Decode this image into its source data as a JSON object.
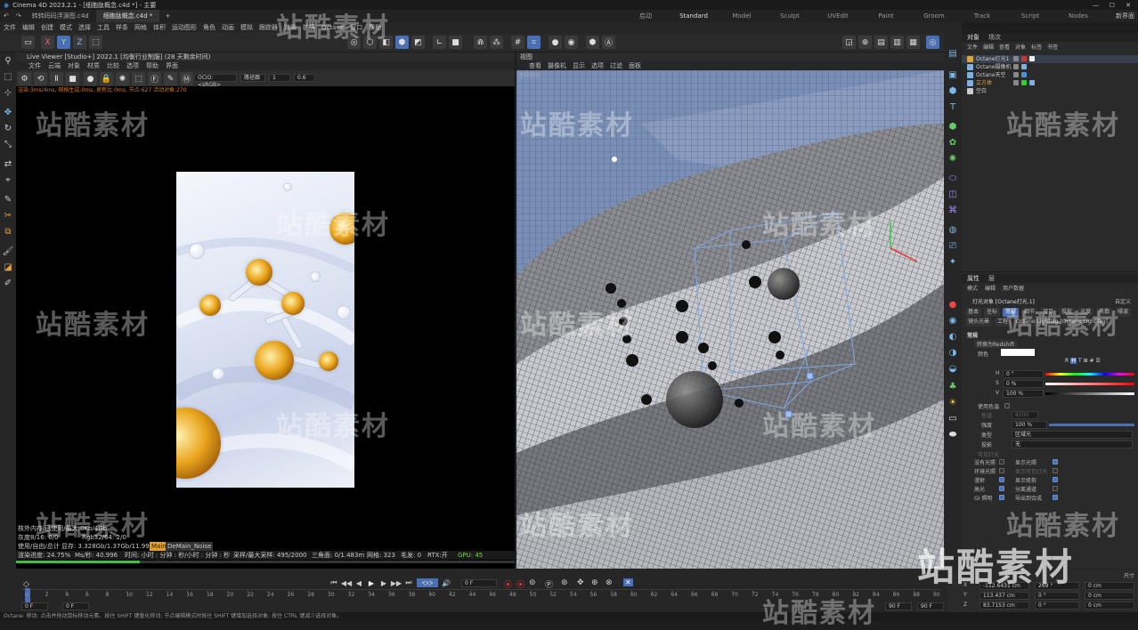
{
  "window": {
    "title": "Cinema 4D 2023.2.1 - [细胞肽概念.c4d *] - 主要"
  },
  "tabs": [
    {
      "label": "转转码码浮源图.c4d"
    },
    {
      "label": "细胞肽概念.c4d *"
    }
  ],
  "layouts": [
    "启动",
    "Standard",
    "Model",
    "Sculpt",
    "UVEdit",
    "Paint",
    "Groom",
    "Track",
    "Script",
    "Nodes"
  ],
  "layout_extra": "新界面",
  "menu": [
    "文件",
    "编辑",
    "创建",
    "模式",
    "选择",
    "工具",
    "样条",
    "网格",
    "体积",
    "运动图形",
    "角色",
    "动画",
    "模拟",
    "跟踪器",
    "渲染",
    "扩展",
    "Octane",
    "窗口",
    "帮助"
  ],
  "live_viewer": {
    "title": "Live Viewer [Studio+] 2022.1 [均衡行业制服] (28 天剩余时间)",
    "menu": [
      "文件",
      "云端",
      "对象",
      "材质",
      "比较",
      "选项",
      "帮助",
      "界面"
    ],
    "color_mode": "OCIO:<sRGB>",
    "preset": "路径跟",
    "value1": "1",
    "value2": "0.6",
    "status": "渲染:3ms/4ms, 网格生成:0ms, 更新比:0ms, 节点:627 活动对象:270",
    "stats": {
      "mem": "核外内存 已使用/最大:0Kb/4Gb",
      "gray": "灰度8/16: 0/0",
      "rgb": "Rgb32/64: 2/0",
      "vram_label": "使用/自由/总计 显存: 3.328Gb/1.37Gb/11.99",
      "pass_main": "Main",
      "pass_noise": "DeMain_Noise",
      "progress_label": "渲染进度: 24.75%",
      "ms": "Ms/秒: 40.996",
      "time": "时间: 小时 : 分钟 : 秒/小时 : 分钟 : 秒",
      "samples": "采样/最大采样: 495/2000",
      "tris": "三角面: 0/1.483m",
      "mesh": "网格: 323",
      "hair": "毛发: 0",
      "rtx": "RTX:开",
      "gpu": "GPU: 45",
      "progress": 0.2475
    }
  },
  "viewport": {
    "title": "视图",
    "menu": [
      "查看",
      "摄像机",
      "显示",
      "选项",
      "过滤",
      "面板"
    ],
    "tag": "透视视图"
  },
  "object_manager": {
    "tabs": [
      "对象",
      "场次"
    ],
    "menu": [
      "文件",
      "编辑",
      "查看",
      "对象",
      "标签",
      "书签"
    ],
    "objects": [
      {
        "name": "Octane灯光1",
        "color": "#d9a640"
      },
      {
        "name": "Octane摄像机",
        "color": "#7fb0e0"
      },
      {
        "name": "Octane天空",
        "color": "#7fb0e0"
      },
      {
        "name": "立方体",
        "color": "#7fb0e0"
      },
      {
        "name": "空白",
        "color": "#cccccc"
      }
    ]
  },
  "attributes": {
    "tabs": [
      "属性",
      "层"
    ],
    "menu": [
      "模式",
      "编辑",
      "用户数据"
    ],
    "object_title": "灯光对象 [Octane灯光.1]",
    "custom": "自定义",
    "subtabs1": [
      "基本",
      "坐标",
      "常规",
      "细节",
      "可见",
      "投影",
      "光度",
      "焦散",
      "噪波"
    ],
    "subtabs2": [
      "镜头光晕",
      "工程",
      "Octane Lightlag [Octane LightTag]"
    ],
    "section": "常规",
    "convert": "转换为Redshift",
    "color_label": "颜色",
    "h_label": "H",
    "h_value": "0 °",
    "s_label": "S",
    "s_value": "0 %",
    "v_label": "V",
    "v_value": "100 %",
    "use_temp": "使用色温",
    "temp_label": "色温",
    "temp_value": "6500",
    "intensity_label": "强度",
    "intensity_value": "100 %",
    "type_label": "类型",
    "type_value": "区域光",
    "shadow_label": "投影",
    "shadow_value": "无",
    "visible_light": "可见灯光",
    "opts_left": [
      "没有光照",
      "环境光照",
      "漫射",
      "高光",
      "GI 照明"
    ],
    "opts_right": [
      "显示光照",
      "显示可见灯光",
      "显示修剪",
      "分离通道",
      "导出到合成"
    ]
  },
  "timeline": {
    "current_frame": "0 F",
    "start": "0 F",
    "start2": "0 F",
    "end": "90 F",
    "end2": "90 F",
    "ticks": [
      "0",
      "2",
      "4",
      "6",
      "8",
      "10",
      "12",
      "14",
      "16",
      "18",
      "20",
      "22",
      "24",
      "26",
      "28",
      "30",
      "32",
      "34",
      "36",
      "38",
      "40",
      "42",
      "44",
      "46",
      "48",
      "50",
      "52",
      "54",
      "56",
      "58",
      "60",
      "62",
      "64",
      "66",
      "68",
      "70",
      "72",
      "74",
      "76",
      "78",
      "80",
      "82",
      "84",
      "86",
      "88",
      "90"
    ],
    "coords": [
      {
        "axis": "X",
        "pos": "-112.6431 cm",
        "rot": "269 °",
        "size": "0 cm"
      },
      {
        "axis": "Y",
        "pos": "113.437 cm",
        "rot": "0 °",
        "size": "0 cm"
      },
      {
        "axis": "Z",
        "pos": "83.7153 cm",
        "rot": "0 °",
        "size": "0 cm"
      }
    ],
    "coord_mode": "尺寸"
  },
  "status": "Octane:    移动: 点击并拖动鼠标移动元素。按住 SHIFT 键量化移动; 节点编辑模式时按住 SHIFT 键增加选择对象; 按住 CTRL 键减少选择对象。",
  "watermark": "站酷素材",
  "colors": {
    "accent": "#4a6fb3",
    "gold": "#e9a51c",
    "status_orange": "#d47a1e"
  }
}
